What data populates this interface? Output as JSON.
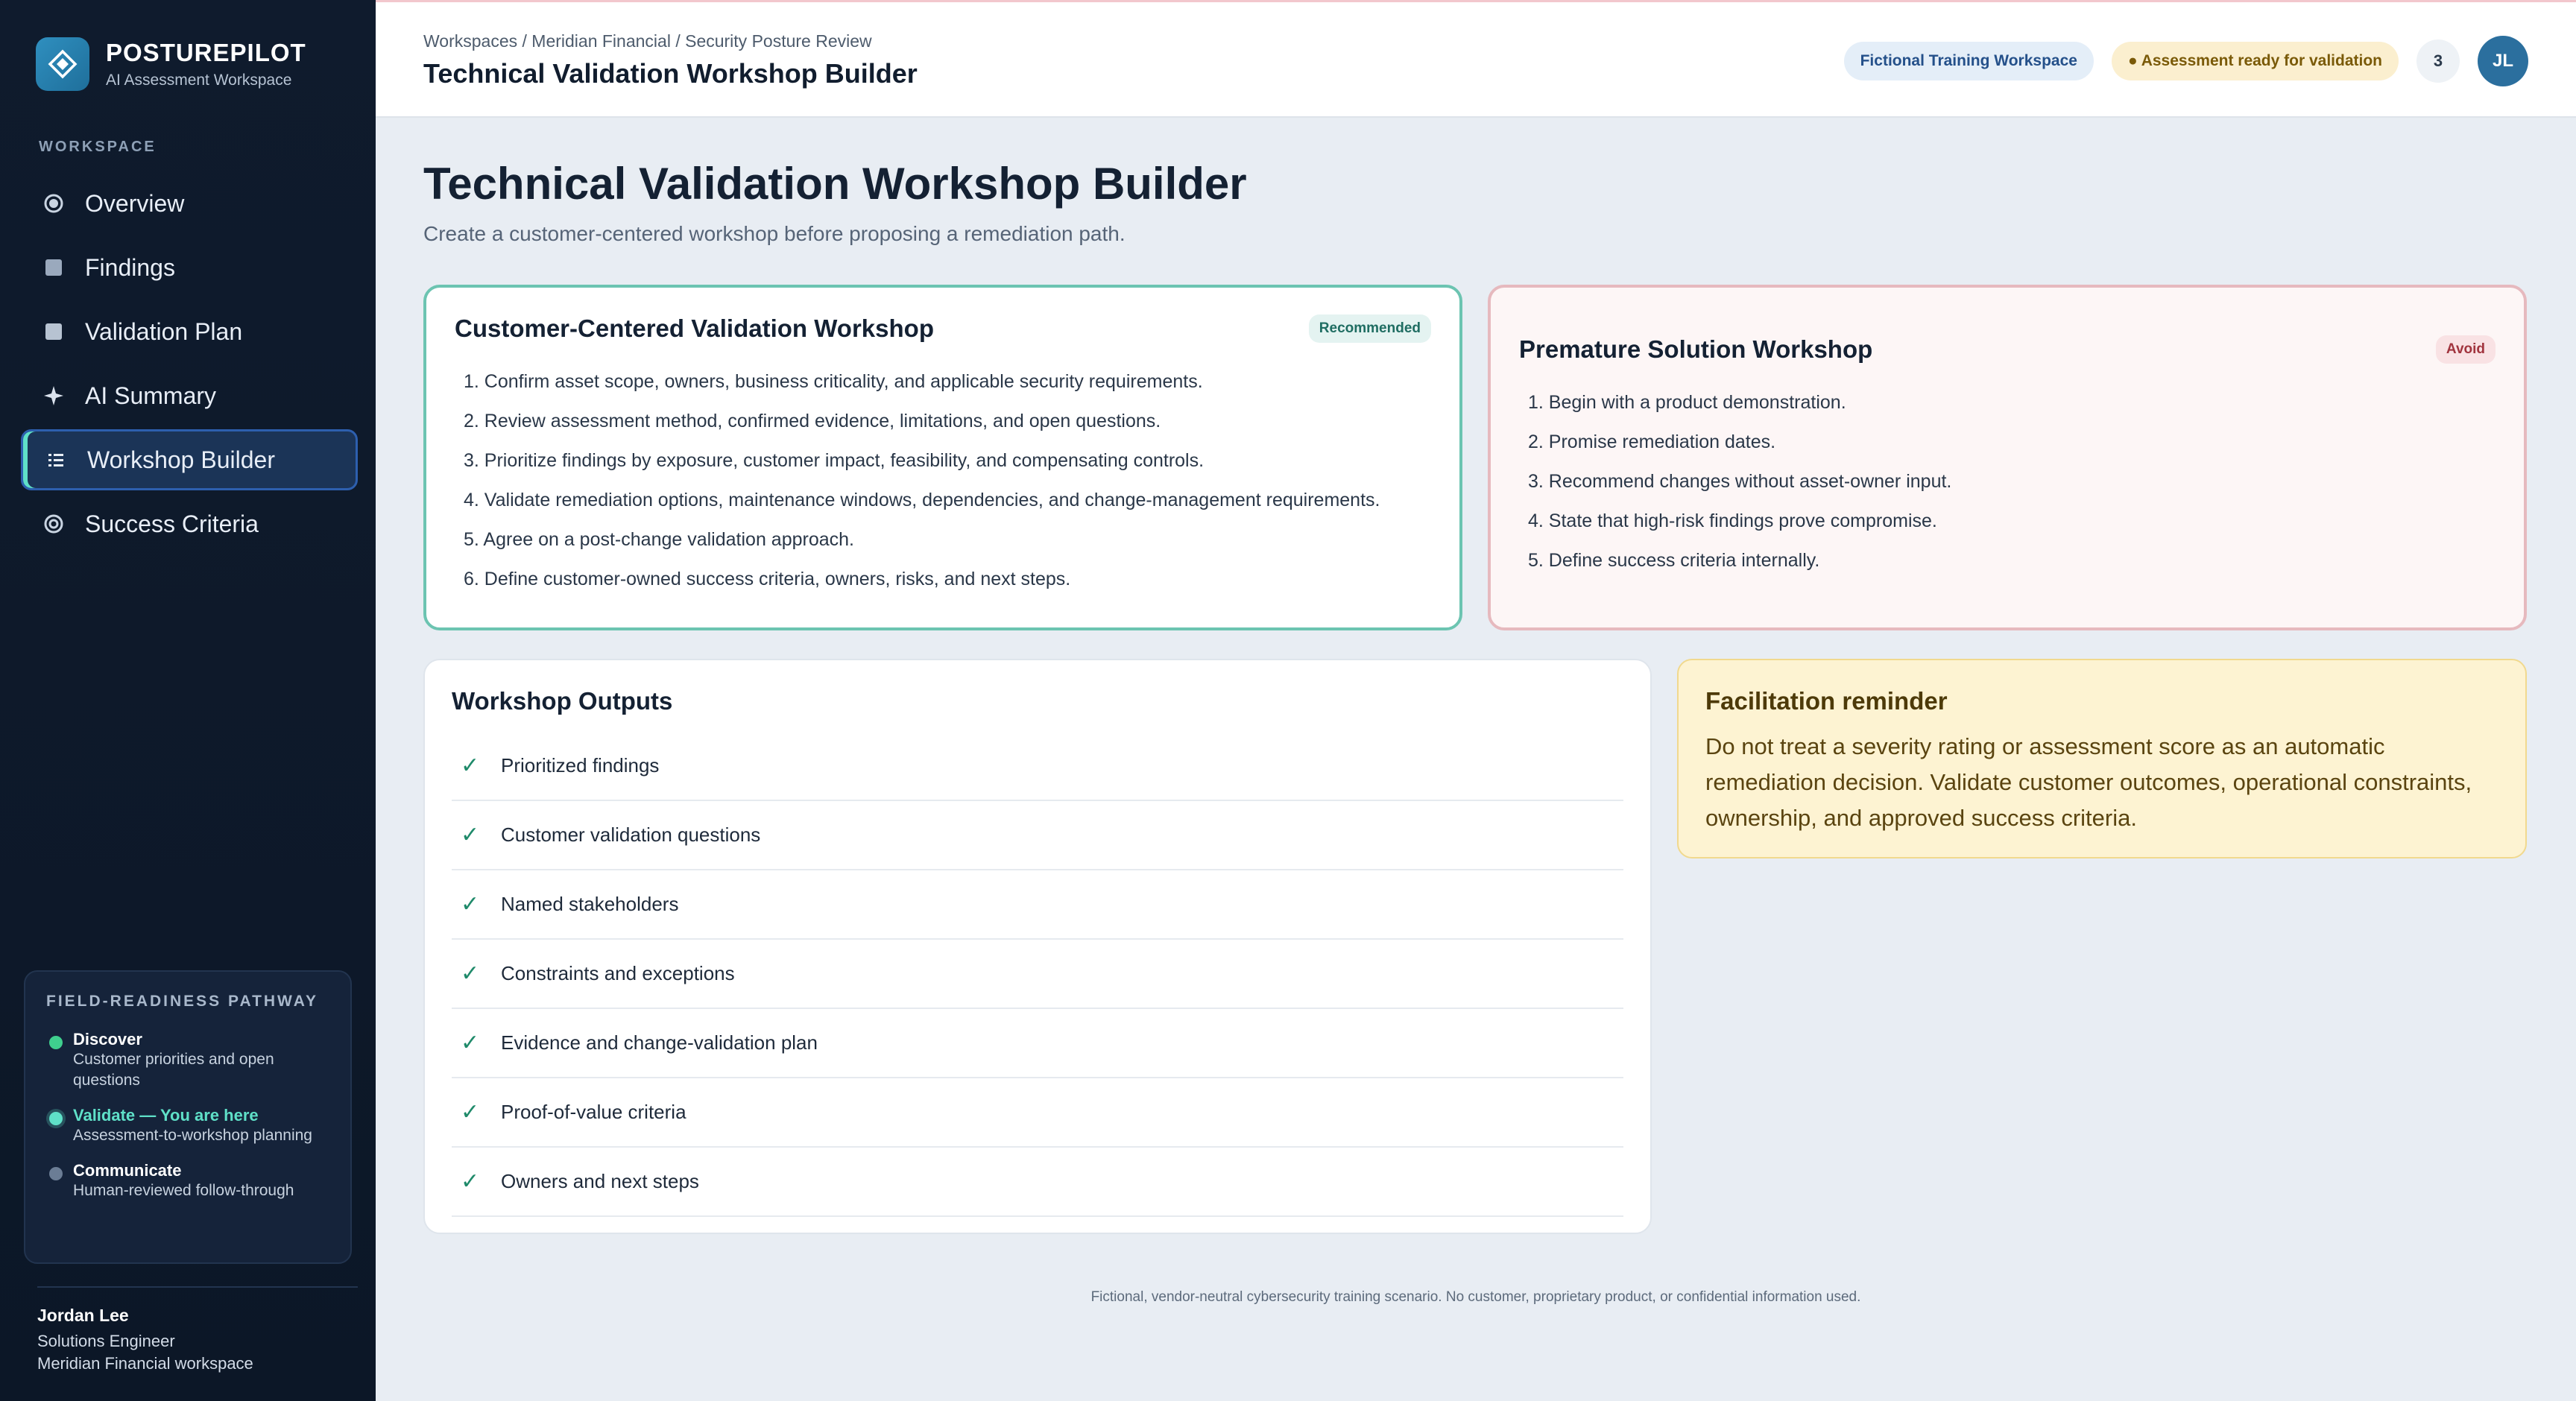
{
  "brand": {
    "name": "POSTUREPILOT",
    "subtitle": "AI Assessment Workspace"
  },
  "sidebar": {
    "section_label": "WORKSPACE",
    "items": [
      {
        "label": "Overview",
        "icon": "radio-icon",
        "active": false
      },
      {
        "label": "Findings",
        "icon": "square-icon",
        "active": false
      },
      {
        "label": "Validation Plan",
        "icon": "square-icon",
        "active": false
      },
      {
        "label": "AI Summary",
        "icon": "sparkle-icon",
        "active": false
      },
      {
        "label": "Workshop Builder",
        "icon": "list-icon",
        "active": true
      },
      {
        "label": "Success Criteria",
        "icon": "target-icon",
        "active": false
      }
    ],
    "pathway": {
      "title": "FIELD-READINESS PATHWAY",
      "steps": [
        {
          "title": "Discover",
          "desc": "Customer priorities and open questions",
          "color": "#3fcf8e"
        },
        {
          "title": "Validate — You are here",
          "desc": "Assessment-to-workshop planning",
          "color": "#5fe0c8"
        },
        {
          "title": "Communicate",
          "desc": "Human-reviewed follow-through",
          "color": "#6b7d95"
        }
      ]
    },
    "user": {
      "name": "Jordan Lee",
      "role": "Solutions Engineer",
      "workspace": "Meridian Financial workspace"
    }
  },
  "topbar": {
    "breadcrumb": "Workspaces / Meridian Financial / Security Posture Review",
    "title": "Technical Validation Workshop Builder",
    "workspace_pill": "Fictional Training Workspace",
    "status_pill": "● Assessment ready for validation",
    "notification_count": "3",
    "avatar_initials": "JL"
  },
  "main": {
    "title": "Technical Validation Workshop Builder",
    "subtitle": "Create a customer-centered workshop before proposing a remediation path.",
    "recommended": {
      "title": "Customer-Centered Validation Workshop",
      "badge": "Recommended",
      "steps": [
        "1. Confirm asset scope, owners, business criticality, and applicable security requirements.",
        "2. Review assessment method, confirmed evidence, limitations, and open questions.",
        "3. Prioritize findings by exposure, customer impact, feasibility, and compensating controls.",
        "4. Validate remediation options, maintenance windows, dependencies, and change-management requirements.",
        "5. Agree on a post-change validation approach.",
        "6. Define customer-owned success criteria, owners, risks, and next steps."
      ]
    },
    "avoid": {
      "title": "Premature Solution Workshop",
      "badge": "Avoid",
      "steps": [
        "1. Begin with a product demonstration.",
        "2. Promise remediation dates.",
        "3. Recommend changes without asset-owner input.",
        "4. State that high-risk findings prove compromise.",
        "5. Define success criteria internally."
      ]
    },
    "outputs": {
      "title": "Workshop Outputs",
      "items": [
        "Prioritized findings",
        "Customer validation questions",
        "Named stakeholders",
        "Constraints and exceptions",
        "Evidence and change-validation plan",
        "Proof-of-value criteria",
        "Owners and next steps"
      ]
    },
    "reminder": {
      "title": "Facilitation reminder",
      "body": "Do not treat a severity rating or assessment score as an automatic remediation decision. Validate customer outcomes, operational constraints, ownership, and approved success criteria."
    },
    "footer": "Fictional, vendor-neutral cybersecurity training scenario. No customer, proprietary product, or confidential information used."
  }
}
